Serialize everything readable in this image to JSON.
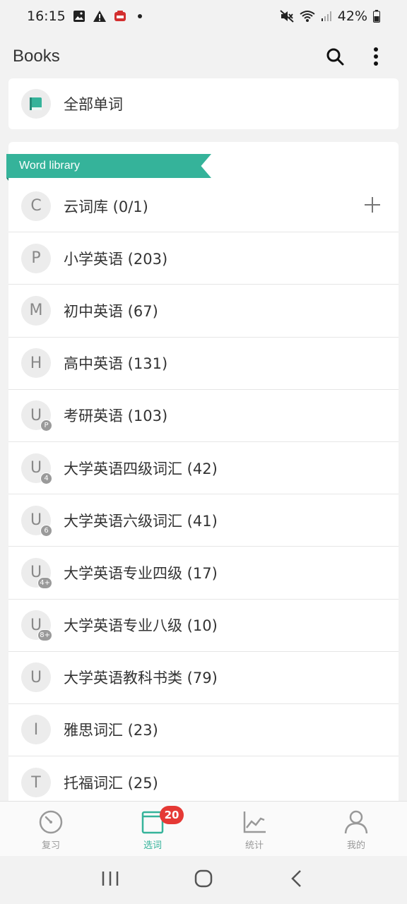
{
  "status_bar": {
    "time": "16:15",
    "battery": "42%",
    "icons": [
      "image-icon",
      "warning-icon",
      "notification-app-icon",
      "dot-icon",
      "mute-icon",
      "wifi-icon",
      "signal-icon",
      "battery-icon"
    ]
  },
  "app_bar": {
    "title": "Books",
    "actions": [
      "search-icon",
      "more-vert-icon"
    ]
  },
  "all_words": {
    "label": "全部单词",
    "icon": "book-icon",
    "accent": "#35b39a"
  },
  "library": {
    "ribbon_label": "Word library",
    "ribbon_color": "#35b39a",
    "items": [
      {
        "letter": "C",
        "badge": "",
        "label": "云词库 (0/1)",
        "action": "add-icon"
      },
      {
        "letter": "P",
        "badge": "",
        "label": "小学英语 (203)"
      },
      {
        "letter": "M",
        "badge": "",
        "label": "初中英语 (67)"
      },
      {
        "letter": "H",
        "badge": "",
        "label": "高中英语 (131)"
      },
      {
        "letter": "U",
        "badge": "P",
        "label": "考研英语 (103)"
      },
      {
        "letter": "U",
        "badge": "4",
        "label": "大学英语四级词汇 (42)"
      },
      {
        "letter": "U",
        "badge": "6",
        "label": "大学英语六级词汇 (41)"
      },
      {
        "letter": "U",
        "badge": "4+",
        "label": "大学英语专业四级 (17)"
      },
      {
        "letter": "U",
        "badge": "8+",
        "label": "大学英语专业八级 (10)"
      },
      {
        "letter": "U",
        "badge": "",
        "label": "大学英语教科书类 (79)"
      },
      {
        "letter": "I",
        "badge": "",
        "label": "雅思词汇 (23)"
      },
      {
        "letter": "T",
        "badge": "",
        "label": "托福词汇 (25)"
      }
    ]
  },
  "bottom_nav": {
    "items": [
      {
        "label": "复习",
        "icon": "review-gauge-icon",
        "active": false
      },
      {
        "label": "选词",
        "icon": "book-select-icon",
        "active": true,
        "badge": "20"
      },
      {
        "label": "统计",
        "icon": "chart-icon",
        "active": false
      },
      {
        "label": "我的",
        "icon": "person-icon",
        "active": false
      }
    ],
    "active_color": "#35b39a",
    "badge_color": "#e53935"
  },
  "system_nav": [
    "recents-icon",
    "home-icon",
    "back-icon"
  ]
}
